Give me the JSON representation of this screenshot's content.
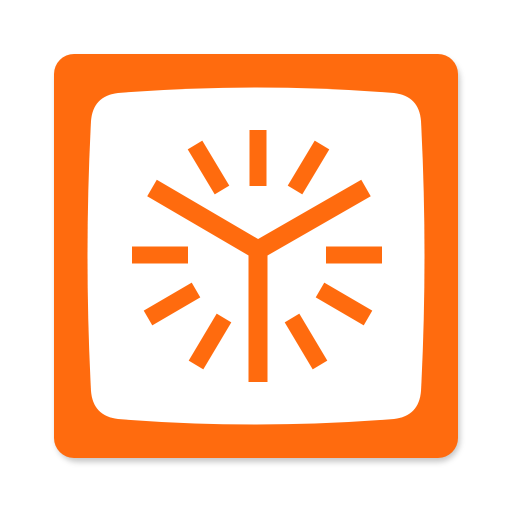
{
  "app_icon": {
    "icon": "clock-icon",
    "colors": {
      "brand_orange": "#FF6B0E",
      "tile_edge": "#E8600C",
      "inner_screen": "#FFFFFF",
      "shadow": "#B9B9B9"
    }
  }
}
